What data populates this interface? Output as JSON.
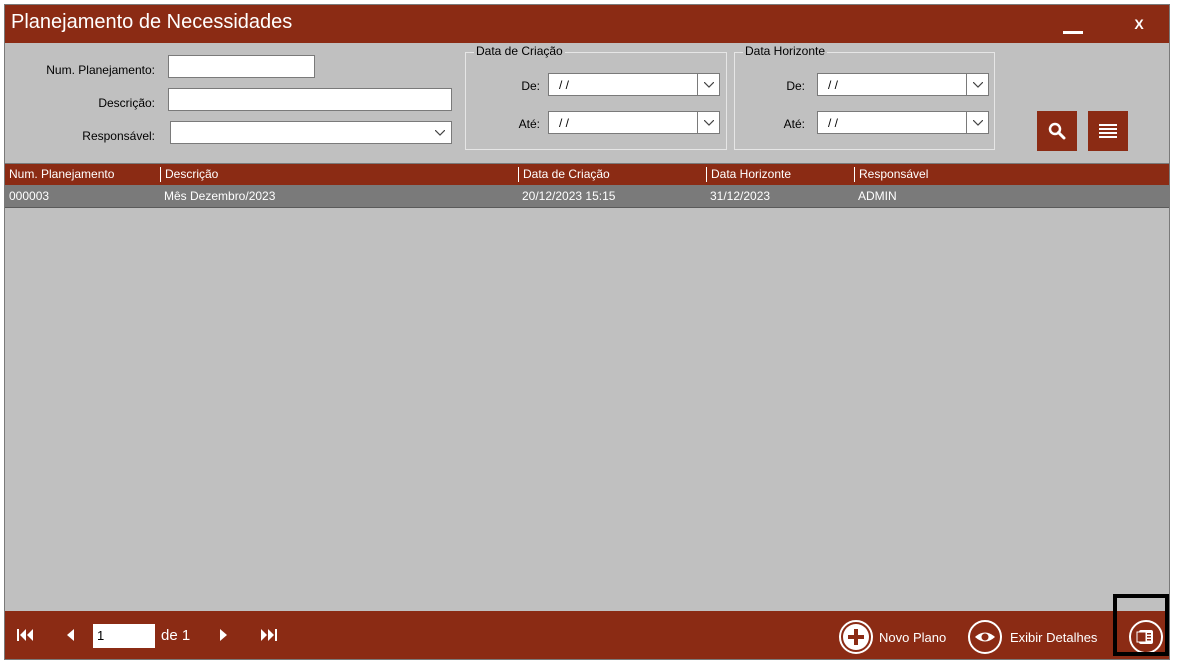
{
  "window": {
    "title": "Planejamento de Necessidades",
    "minimize_label": "—",
    "close_label": "X"
  },
  "filters": {
    "num_planejamento_label": "Num. Planejamento:",
    "num_planejamento_value": "",
    "descricao_label": "Descrição:",
    "descricao_value": "",
    "responsavel_label": "Responsável:",
    "responsavel_value": "",
    "data_criacao": {
      "title": "Data de Criação",
      "de_label": "De:",
      "de_value": "/ /",
      "ate_label": "Até:",
      "ate_value": "/ /"
    },
    "data_horizonte": {
      "title": "Data Horizonte",
      "de_label": "De:",
      "de_value": "/ /",
      "ate_label": "Até:",
      "ate_value": "/ /"
    }
  },
  "grid": {
    "columns": [
      "Num. Planejamento",
      "Descrição",
      "Data de Criação",
      "Data Horizonte",
      "Responsável"
    ],
    "rows": [
      [
        "000003",
        "Mês Dezembro/2023",
        "20/12/2023 15:15",
        "31/12/2023",
        "ADMIN"
      ]
    ]
  },
  "footer": {
    "page_current": "1",
    "page_of": "de 1",
    "novo_plano_label": "Novo Plano",
    "exibir_detalhes_label": "Exibir Detalhes"
  },
  "colors": {
    "accent": "#8b2b14",
    "background": "#c0c0c0",
    "selected_row": "#7a7a7a"
  }
}
